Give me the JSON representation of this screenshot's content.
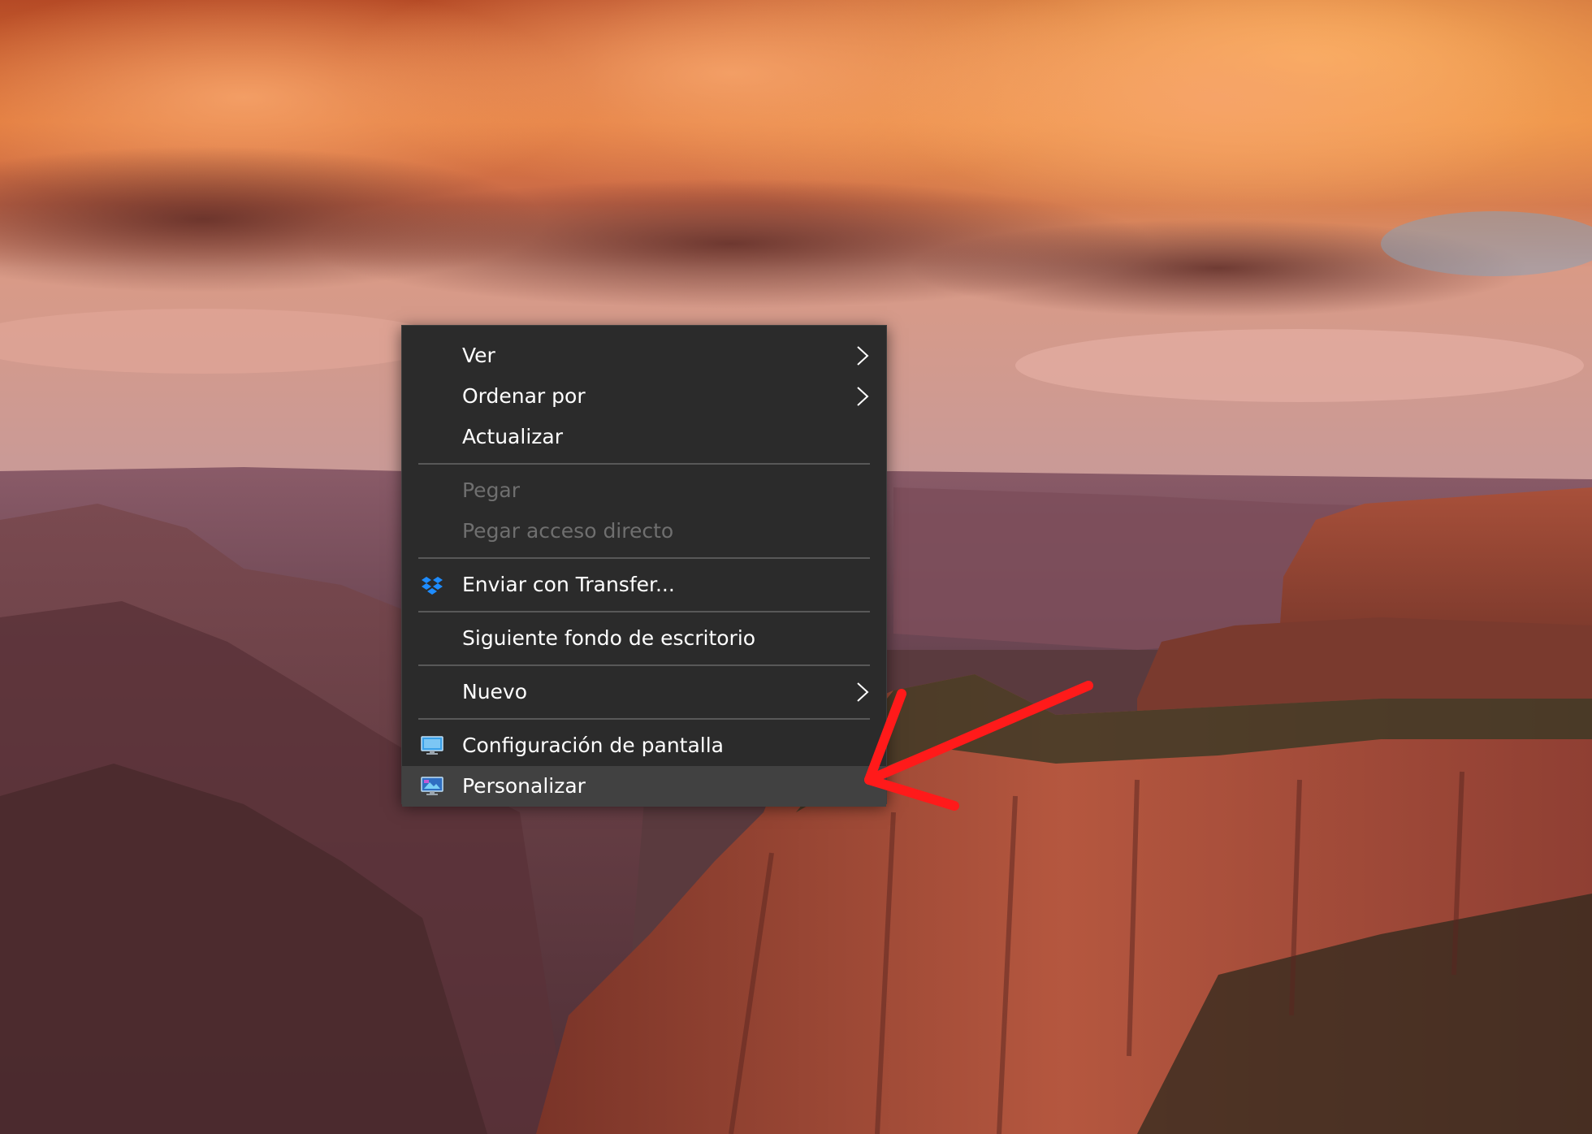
{
  "context_menu": {
    "items": [
      {
        "label": "Ver",
        "submenu": true,
        "disabled": false
      },
      {
        "label": "Ordenar por",
        "submenu": true,
        "disabled": false
      },
      {
        "label": "Actualizar",
        "submenu": false,
        "disabled": false
      },
      {
        "label": "Pegar",
        "submenu": false,
        "disabled": true
      },
      {
        "label": "Pegar acceso directo",
        "submenu": false,
        "disabled": true
      },
      {
        "label": "Enviar con Transfer...",
        "submenu": false,
        "disabled": false,
        "icon": "dropbox-icon"
      },
      {
        "label": "Siguiente fondo de escritorio",
        "submenu": false,
        "disabled": false
      },
      {
        "label": "Nuevo",
        "submenu": true,
        "disabled": false
      },
      {
        "label": "Configuración de pantalla",
        "submenu": false,
        "disabled": false,
        "icon": "display-settings-icon"
      },
      {
        "label": "Personalizar",
        "submenu": false,
        "disabled": false,
        "highlighted": true,
        "icon": "personalize-icon"
      }
    ]
  },
  "colors": {
    "menu_background": "#2b2b2b",
    "menu_text": "#ffffff",
    "menu_text_disabled": "#6f6f6f",
    "menu_highlight": "#414141",
    "separator": "#585858",
    "annotation": "#ff1a1a"
  },
  "annotation": {
    "type": "arrow",
    "points_to": "Personalizar",
    "icon": "red-arrow-icon"
  }
}
